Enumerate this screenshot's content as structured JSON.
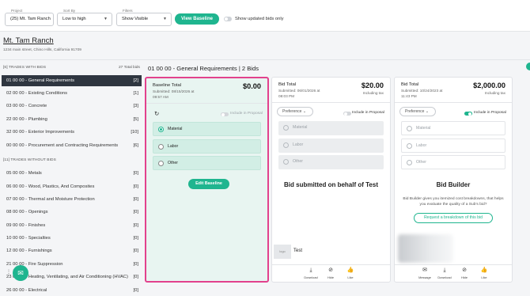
{
  "filters": {
    "project": {
      "label": "Project",
      "value": "(25) Mt. Tam Ranch"
    },
    "sort": {
      "label": "Sort By",
      "value": "Low to high"
    },
    "filter": {
      "label": "Filters",
      "value": "Show Visible"
    },
    "view_baseline": "View Baseline",
    "updated_only_label": "Show updated bids only",
    "updated_only_on": false
  },
  "project": {
    "name": "Mt. Tam Ranch",
    "address": "1234 main street, Chino Hills, California 91709"
  },
  "sidebar": {
    "with_bids_header": "[6] TRADES WITH BIDS",
    "total_bids": "27 Total bids",
    "with_bids": [
      {
        "label": "01 00 00 - General Requirements",
        "count": "[2]",
        "active": true
      },
      {
        "label": "02 00 00 - Existing Conditions",
        "count": "[1]"
      },
      {
        "label": "03 00 00 - Concrete",
        "count": "[3]"
      },
      {
        "label": "22 00 00 - Plumbing",
        "count": "[5]"
      },
      {
        "label": "32 00 00 - Exterior Improvements",
        "count": "[10]"
      },
      {
        "label": "00 00 00 - Procurement and Contracting Requirements",
        "count": "[6]"
      }
    ],
    "without_bids_header": "[11] TRADES WITHOUT BIDS",
    "without_bids": [
      {
        "label": "05 00 00 - Metals",
        "count": "[0]"
      },
      {
        "label": "06 00 00 - Wood, Plastics, And Composites",
        "count": "[0]"
      },
      {
        "label": "07 00 00 - Thermal and Moisture Protection",
        "count": "[0]"
      },
      {
        "label": "08 00 00 - Openings",
        "count": "[0]"
      },
      {
        "label": "09 00 00 - Finishes",
        "count": "[0]"
      },
      {
        "label": "10 00 00 - Specialties",
        "count": "[0]"
      },
      {
        "label": "12 00 00 - Furnishings",
        "count": "[0]"
      },
      {
        "label": "21 00 00 - Fire Suppression",
        "count": "[0]"
      },
      {
        "label": "23 00 00 - Heating, Ventilating, and Air Conditioning (HVAC)",
        "count": "[0]"
      },
      {
        "label": "26 00 00 - Electrical",
        "count": "[0]"
      }
    ]
  },
  "section_title": "01 00 00 - General Requirements | 2 Bids",
  "baseline": {
    "title": "Baseline Total",
    "amount": "$0.00",
    "submitted": "Submitted: 08/15/2026 at",
    "time": "09:57 AM",
    "include_label": "Include in Proposal",
    "options": [
      "Material",
      "Labor",
      "Other"
    ],
    "selected": "Material",
    "edit_button": "Edit Baseline"
  },
  "bid1": {
    "title": "Bid Total",
    "amount": "$20.00",
    "submitted": "Submitted: 06/01/2026 at",
    "time": "08:03 PM",
    "tax": "Including tax",
    "preference": "Preference",
    "include_label": "Include in Proposal",
    "include_on": false,
    "options": [
      "Material",
      "Labor",
      "Other"
    ],
    "message": "Bid submitted on behalf of Test",
    "logo_text": "logo",
    "bidder": "Test",
    "actions": [
      "Download",
      "Hide",
      "Like"
    ]
  },
  "bid2": {
    "title": "Bid Total",
    "amount": "$2,000.00",
    "submitted": "Submitted: 10/24/2023 at",
    "time": "11:43 PM",
    "tax": "Including tax",
    "preference": "Preference",
    "include_label": "Include in Proposal",
    "include_on": true,
    "options": [
      "Material",
      "Labor",
      "Other"
    ],
    "heading": "Bid Builder",
    "body": "Bid Builder gives you itemized cost breakdowns, that helps you evaluate the quality of a Sub's bid?",
    "request_button": "Request a breakdown of this bid",
    "actions": [
      "Message",
      "Download",
      "Hide",
      "Like"
    ]
  },
  "colors": {
    "accent": "#1fb58f",
    "highlight_border": "#e2418d",
    "sidebar_active": "#2f3640"
  },
  "icons": [
    "chevron-down-icon",
    "refresh-icon",
    "download-icon",
    "hide-icon",
    "like-icon",
    "message-icon",
    "chat-icon",
    "drag-dots-icon"
  ]
}
